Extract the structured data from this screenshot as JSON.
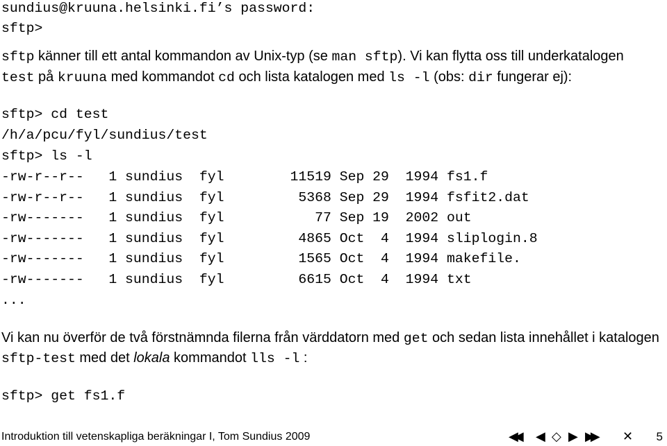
{
  "prompt_lines": {
    "password": "sundius@kruuna.helsinki.fi’s password:",
    "sftp_prompt": "sftp>"
  },
  "para1": {
    "a": "sftp",
    "b": " känner till ett antal kommandon av Unix-typ (se ",
    "c": "man sftp",
    "d": "). Vi kan flytta oss till underkatalogen",
    "e": "test",
    "f": " på ",
    "g": "kruuna",
    "h": " med kommandot ",
    "i": "cd",
    "j": " och lista katalogen med ",
    "k": "ls -l",
    "l": " (obs: ",
    "m": "dir",
    "n": " fungerar ej):"
  },
  "session": {
    "cmd1": "sftp> cd test",
    "path": "/h/a/pcu/fyl/sundius/test",
    "cmd2": "sftp> ls -l",
    "ellipsis": "..."
  },
  "listing": [
    {
      "perms": "-rw-r--r--",
      "links": "1",
      "owner": "sundius",
      "group": "fyl",
      "size": "11519",
      "month": "Sep",
      "day": "29",
      "year": "1994",
      "name": "fs1.f"
    },
    {
      "perms": "-rw-r--r--",
      "links": "1",
      "owner": "sundius",
      "group": "fyl",
      "size": "5368",
      "month": "Sep",
      "day": "29",
      "year": "1994",
      "name": "fsfit2.dat"
    },
    {
      "perms": "-rw-------",
      "links": "1",
      "owner": "sundius",
      "group": "fyl",
      "size": "77",
      "month": "Sep",
      "day": "19",
      "year": "2002",
      "name": "out"
    },
    {
      "perms": "-rw-------",
      "links": "1",
      "owner": "sundius",
      "group": "fyl",
      "size": "4865",
      "month": "Oct",
      "day": "4",
      "year": "1994",
      "name": "sliplogin.8"
    },
    {
      "perms": "-rw-------",
      "links": "1",
      "owner": "sundius",
      "group": "fyl",
      "size": "1565",
      "month": "Oct",
      "day": "4",
      "year": "1994",
      "name": "makefile."
    },
    {
      "perms": "-rw-------",
      "links": "1",
      "owner": "sundius",
      "group": "fyl",
      "size": "6615",
      "month": "Oct",
      "day": "4",
      "year": "1994",
      "name": "txt"
    }
  ],
  "para2": {
    "a": "Vi kan nu överför de två förstnämnda filerna från värddatorn med ",
    "b": "get",
    "c": " och sedan lista innehållet i katalogen",
    "d": "sftp-test",
    "e": " med det ",
    "f": "lokala",
    "g": " kommandot ",
    "h": "lls -l",
    "i": " :"
  },
  "final_cmd": "sftp> get fs1.f",
  "footer": {
    "title": "Introduktion till vetenskapliga beräkningar I, Tom Sundius 2009",
    "nav": {
      "first": "◀◀",
      "prev": "◀",
      "home": "◇",
      "next": "▶",
      "last": "▶▶",
      "close": "✕"
    },
    "page": "5"
  }
}
